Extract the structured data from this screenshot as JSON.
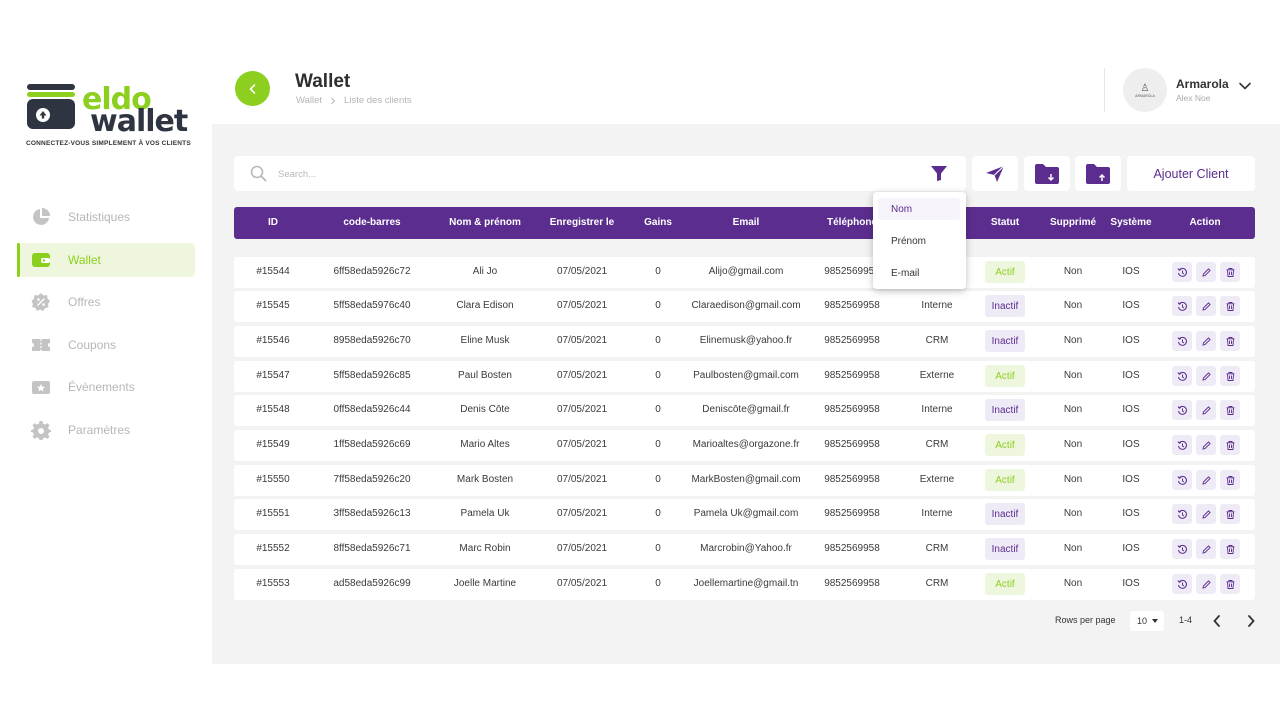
{
  "brand": {
    "word1": "eldo",
    "word2": "wallet",
    "tagline": "CONNECTEZ-VOUS SIMPLEMENT À VOS CLIENTS",
    "accent": "#8ccf1f",
    "purple": "#5b2d8e"
  },
  "sidebar": {
    "items": [
      {
        "label": "Statistiques",
        "icon": "pie-chart-icon",
        "active": false
      },
      {
        "label": "Wallet",
        "icon": "wallet-icon",
        "active": true
      },
      {
        "label": "Offres",
        "icon": "badge-percent-icon",
        "active": false
      },
      {
        "label": "Coupons",
        "icon": "ticket-icon",
        "active": false
      },
      {
        "label": "Évènements",
        "icon": "event-icon",
        "active": false
      },
      {
        "label": "Paramètres",
        "icon": "gear-icon",
        "active": false
      }
    ]
  },
  "header": {
    "title": "Wallet",
    "breadcrumb": [
      "Wallet",
      "Liste des clients"
    ],
    "user": {
      "name": "Armarola",
      "sub": "Alex Noe",
      "avatar_text": "ARMAROLA"
    }
  },
  "toolbar": {
    "search_placeholder": "Search...",
    "add_client_label": "Ajouter Client"
  },
  "filter_menu": {
    "options": [
      "Nom",
      "Prénom",
      "E-mail"
    ],
    "selected": "Nom"
  },
  "table": {
    "columns": [
      "ID",
      "code-barres",
      "Nom & prénom",
      "Enregistrer le",
      "Gains",
      "Email",
      "Téléphone",
      "Statut",
      "Supprimé",
      "Système",
      "Action"
    ],
    "rows": [
      {
        "id": "#15544",
        "code": "6ff58eda5926c72",
        "name": "Ali Jo",
        "date": "07/05/2021",
        "gains": "0",
        "email": "Alijo@gmail.com",
        "phone": "9852569958",
        "source": "",
        "status": "Actif",
        "deleted": "Non",
        "system": "IOS"
      },
      {
        "id": "#15545",
        "code": "5ff58eda5976c40",
        "name": "Clara Edison",
        "date": "07/05/2021",
        "gains": "0",
        "email": "Claraedison@gmail.com",
        "phone": "9852569958",
        "source": "Interne",
        "status": "Inactif",
        "deleted": "Non",
        "system": "IOS"
      },
      {
        "id": "#15546",
        "code": "8958eda5926c70",
        "name": "Eline Musk",
        "date": "07/05/2021",
        "gains": "0",
        "email": "Elinemusk@yahoo.fr",
        "phone": "9852569958",
        "source": "CRM",
        "status": "Inactif",
        "deleted": "Non",
        "system": "IOS"
      },
      {
        "id": "#15547",
        "code": "5ff58eda5926c85",
        "name": "Paul Bosten",
        "date": "07/05/2021",
        "gains": "0",
        "email": "Paulbosten@gmail.com",
        "phone": "9852569958",
        "source": "Externe",
        "status": "Actif",
        "deleted": "Non",
        "system": "IOS"
      },
      {
        "id": "#15548",
        "code": "0ff58eda5926c44",
        "name": "Denis Cōte",
        "date": "07/05/2021",
        "gains": "0",
        "email": "Deniscōte@gmail.fr",
        "phone": "9852569958",
        "source": "Interne",
        "status": "Inactif",
        "deleted": "Non",
        "system": "IOS"
      },
      {
        "id": "#15549",
        "code": "1ff58eda5926c69",
        "name": "Mario Altes",
        "date": "07/05/2021",
        "gains": "0",
        "email": "Marioaltes@orgazone.fr",
        "phone": "9852569958",
        "source": "CRM",
        "status": "Actif",
        "deleted": "Non",
        "system": "IOS"
      },
      {
        "id": "#15550",
        "code": "7ff58eda5926c20",
        "name": "Mark Bosten",
        "date": "07/05/2021",
        "gains": "0",
        "email": "MarkBosten@gmail.com",
        "phone": "9852569958",
        "source": "Externe",
        "status": "Actif",
        "deleted": "Non",
        "system": "IOS"
      },
      {
        "id": "#15551",
        "code": "3ff58eda5926c13",
        "name": "Pamela Uk",
        "date": "07/05/2021",
        "gains": "0",
        "email": "Pamela Uk@gmail.com",
        "phone": "9852569958",
        "source": "Interne",
        "status": "Inactif",
        "deleted": "Non",
        "system": "IOS"
      },
      {
        "id": "#15552",
        "code": "8ff58eda5926c71",
        "name": "Marc Robin",
        "date": "07/05/2021",
        "gains": "0",
        "email": "Marcrobin@Yahoo.fr",
        "phone": "9852569958",
        "source": "CRM",
        "status": "Inactif",
        "deleted": "Non",
        "system": "IOS"
      },
      {
        "id": "#15553",
        "code": "ad58eda5926c99",
        "name": "Joelle Martine",
        "date": "07/05/2021",
        "gains": "0",
        "email": "Joellemartine@gmail.tn",
        "phone": "9852569958",
        "source": "CRM",
        "status": "Actif",
        "deleted": "Non",
        "system": "IOS"
      }
    ],
    "action_icons": [
      "history-icon",
      "edit-icon",
      "trash-icon"
    ]
  },
  "pagination": {
    "rows_label": "Rows per page",
    "rows_value": "10",
    "range": "1-4"
  }
}
